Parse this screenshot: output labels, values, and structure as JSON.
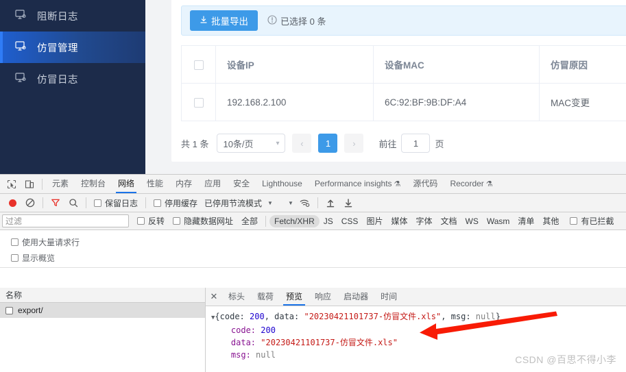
{
  "app": {
    "sidebar": {
      "items": [
        {
          "label": "阻断日志",
          "icon": "monitor-icon",
          "active": false
        },
        {
          "label": "仿冒管理",
          "icon": "monitor-icon",
          "active": true
        },
        {
          "label": "仿冒日志",
          "icon": "monitor-icon",
          "active": false
        }
      ],
      "bg_color": "#1c2b4a",
      "active_color": "#2f7cf6"
    },
    "toolbar": {
      "export_label": "批量导出",
      "export_icon": "download-icon",
      "info_icon": "info-circle-icon",
      "selection_text": "已选择 0 条",
      "accent_color": "#3d9ae8"
    },
    "table": {
      "columns": [
        "设备IP",
        "设备MAC",
        "仿冒原因"
      ],
      "rows": [
        {
          "ip": "192.168.2.100",
          "mac": "6C:92:BF:9B:DF:A4",
          "reason": "MAC变更"
        }
      ]
    },
    "pagination": {
      "total_text": "共 1 条",
      "page_size": "10条/页",
      "prev_icon": "chevron-left-icon",
      "next_icon": "chevron-right-icon",
      "current_page": "1",
      "jump_prefix": "前往",
      "jump_value": "1",
      "jump_suffix": "页"
    }
  },
  "devtools": {
    "tabs": [
      {
        "label": "元素",
        "selected": false,
        "beaker": false
      },
      {
        "label": "控制台",
        "selected": false,
        "beaker": false
      },
      {
        "label": "网络",
        "selected": true,
        "beaker": false
      },
      {
        "label": "性能",
        "selected": false,
        "beaker": false
      },
      {
        "label": "内存",
        "selected": false,
        "beaker": false
      },
      {
        "label": "应用",
        "selected": false,
        "beaker": false
      },
      {
        "label": "安全",
        "selected": false,
        "beaker": false
      },
      {
        "label": "Lighthouse",
        "selected": false,
        "beaker": false
      },
      {
        "label": "Performance insights",
        "selected": false,
        "beaker": true
      },
      {
        "label": "源代码",
        "selected": false,
        "beaker": false
      },
      {
        "label": "Recorder",
        "selected": false,
        "beaker": true
      }
    ],
    "inspect_icon": "inspect-cursor-icon",
    "device_icon": "device-toolbar-icon",
    "beaker_glyph": "⚗",
    "controls": {
      "record_icon": "record-dot-icon",
      "clear_icon": "clear-no-entry-icon",
      "filter_icon": "funnel-icon",
      "search_icon": "search-icon",
      "preserve_log": "保留日志",
      "disable_cache": "停用缓存",
      "throttle_text": "已停用节流模式",
      "caret_icon": "caret-down-icon",
      "wifi_icon": "wifi-settings-icon",
      "import_icon": "upload-arrow-icon",
      "export_icon": "download-arrow-icon"
    },
    "filterbar": {
      "filter_placeholder": "过滤",
      "invert": "反转",
      "hide_data_urls": "隐藏数据网址",
      "types": [
        "全部",
        "Fetch/XHR",
        "JS",
        "CSS",
        "图片",
        "媒体",
        "字体",
        "文档",
        "WS",
        "Wasm",
        "清单",
        "其他"
      ],
      "selected_type": "Fetch/XHR",
      "blocked_cookies": "有已拦截"
    },
    "options": {
      "big_request_rows": "使用大量请求行",
      "show_overview": "显示概览"
    },
    "requests": {
      "header": "名称",
      "items": [
        {
          "name": "export/",
          "selected": true
        }
      ]
    },
    "detail_tabs": [
      {
        "label": "标头",
        "selected": false
      },
      {
        "label": "载荷",
        "selected": false
      },
      {
        "label": "预览",
        "selected": true
      },
      {
        "label": "响应",
        "selected": false
      },
      {
        "label": "启动器",
        "selected": false
      },
      {
        "label": "时间",
        "selected": false
      }
    ],
    "close_icon": "close-x-icon",
    "preview": {
      "toggle_icon": "triangle-down-icon",
      "summary_prefix": "{code: ",
      "summary_code": "200",
      "summary_mid": ", data: ",
      "summary_data": "\"20230421101737-仿冒文件.xls\"",
      "summary_msg_key": ", msg: ",
      "summary_msg": "null",
      "summary_suffix": "}",
      "rows": [
        {
          "key": "code:",
          "value": "200",
          "kind": "num"
        },
        {
          "key": "data:",
          "value": "\"20230421101737-仿冒文件.xls\"",
          "kind": "str"
        },
        {
          "key": "msg:",
          "value": "null",
          "kind": "null"
        }
      ]
    }
  },
  "annotation": {
    "arrow_color": "#f81b05",
    "arrow_name": "red-arrow-pointing-to-data-value"
  },
  "watermark": {
    "text": "CSDN @百思不得小李"
  }
}
